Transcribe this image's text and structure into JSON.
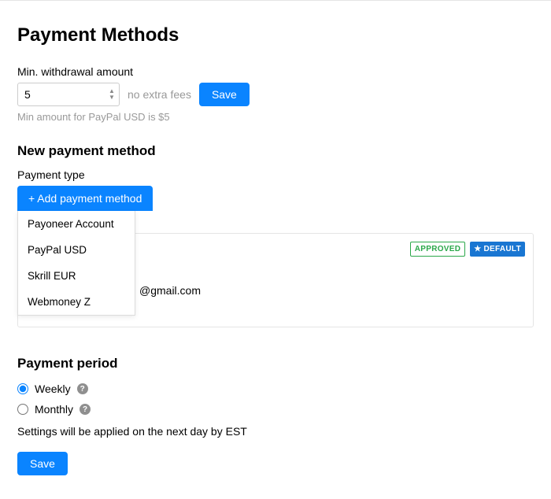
{
  "title": "Payment Methods",
  "withdrawal": {
    "label": "Min. withdrawal amount",
    "value": "5",
    "fees_text": "no extra fees",
    "save_label": "Save",
    "hint": "Min amount for PayPal USD is $5"
  },
  "new_method": {
    "heading": "New payment method",
    "type_label": "Payment type",
    "add_button": "+ Add payment method",
    "options": {
      "0": "Payoneer Account",
      "1": "PayPal USD",
      "2": "Skrill EUR",
      "3": "Webmoney Z"
    }
  },
  "card": {
    "email_partial": "@gmail.com",
    "badge_approved": "APPROVED",
    "badge_default": "DEFAULT"
  },
  "period": {
    "heading": "Payment period",
    "weekly": "Weekly",
    "monthly": "Monthly",
    "note": "Settings will be applied on the next day by EST",
    "save_label": "Save"
  }
}
